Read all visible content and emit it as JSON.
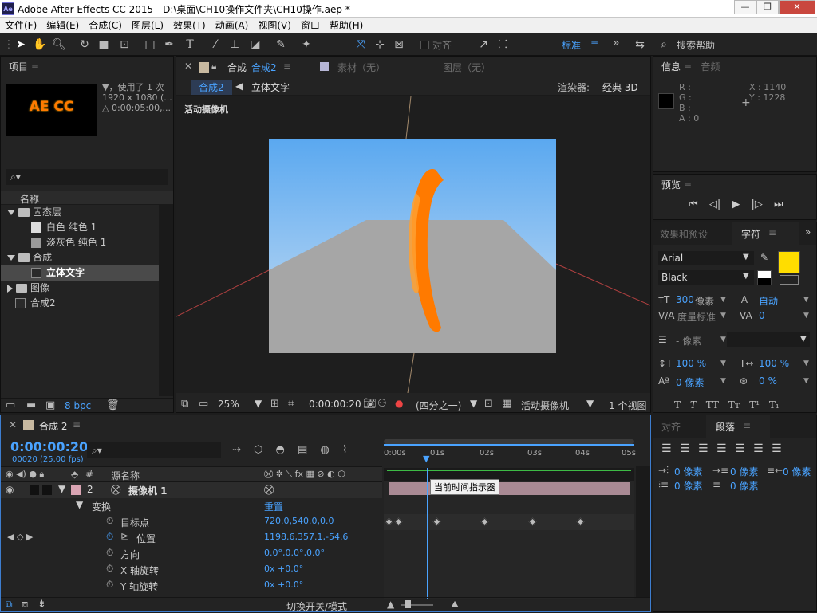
{
  "titlebar": {
    "app_icon": "Ae",
    "title": "Adobe After Effects CC 2015 - D:\\桌面\\CH10操作文件夹\\CH10操作.aep *",
    "minimize": "—",
    "restore": "❐",
    "close": "✕"
  },
  "menu": [
    "文件(F)",
    "编辑(E)",
    "合成(C)",
    "图层(L)",
    "效果(T)",
    "动画(A)",
    "视图(V)",
    "窗口",
    "帮助(H)"
  ],
  "toolbar": {
    "align_label": "对齐",
    "workspace": "标准",
    "search_label": "搜索帮助",
    "menu_icon": "≡",
    "more_icon": "»"
  },
  "project": {
    "title": "项目",
    "thumb_text": "AE CC",
    "info_line1": "▼，使用了 1 次",
    "info_line2": "1920 x 1080  (...",
    "info_line3": "△ 0:00:05:00,...",
    "search_placeholder": "",
    "col_name": "名称",
    "items": [
      {
        "name": "固态层",
        "type": "folder",
        "indent": 0,
        "expanded": true
      },
      {
        "name": "白色 纯色 1",
        "type": "solid-white",
        "indent": 2,
        "expanded": false
      },
      {
        "name": "淡灰色 纯色 1",
        "type": "solid-gray",
        "indent": 2,
        "expanded": false
      },
      {
        "name": "合成",
        "type": "folder",
        "indent": 0,
        "expanded": true
      },
      {
        "name": "立体文字",
        "type": "comp",
        "indent": 2,
        "expanded": false,
        "selected": true
      },
      {
        "name": "图像",
        "type": "folder",
        "indent": 0,
        "expanded": false
      },
      {
        "name": "合成2",
        "type": "comp",
        "indent": 1,
        "expanded": false
      }
    ],
    "bpc": "8 bpc"
  },
  "viewer": {
    "tab_comp_label": "合成",
    "tab_comp_name": "合成2",
    "tab_footage": "素材（无）",
    "tab_layer": "图层（无）",
    "breadcrumb1": "合成2",
    "breadcrumb2": "立体文字",
    "renderer_label": "渲染器:",
    "renderer_value": "经典 3D",
    "camera_label": "活动摄像机",
    "zoom": "25%",
    "timecode": "0:00:00:20",
    "resolution": "(四分之一)",
    "view_camera": "活动摄像机",
    "views": "1 个视图"
  },
  "info": {
    "title": "信息",
    "audio": "音频",
    "r": "R :",
    "g": "G :",
    "b": "B :",
    "a": "A : 0",
    "x": "X : 1140",
    "y": "Y : 1228"
  },
  "preview": {
    "title": "预览"
  },
  "effects_tab": "效果和预设",
  "character": {
    "title": "字符",
    "font": "Arial",
    "style": "Black",
    "size": "300",
    "size_unit": "像素",
    "leading": "自动",
    "kerning": "度量标准",
    "tracking": "0",
    "stroke": "- 像素",
    "vscale": "100 %",
    "hscale": "100 %",
    "baseline": "0 像素",
    "tsume": "0 %",
    "fill_color": "#ffdd00"
  },
  "timeline": {
    "comp_name": "合成 2",
    "timecode": "0:00:00:20",
    "frameinfo": "00020 (25.00 fps)",
    "col_num": "#",
    "col_source": "源名称",
    "ruler": [
      "0:00s",
      "01s",
      "02s",
      "03s",
      "04s",
      "05s"
    ],
    "tooltip": "当前时间指示器",
    "layers": [
      {
        "num": "2",
        "name": "摄像机 1",
        "kind": "layer"
      },
      {
        "name": "变换",
        "kind": "group",
        "value": "重置"
      },
      {
        "name": "目标点",
        "kind": "prop",
        "value": "720.0,540.0,0.0"
      },
      {
        "name": "位置",
        "kind": "prop",
        "value": "1198.6,357.1,-54.6",
        "keys": true
      },
      {
        "name": "方向",
        "kind": "prop",
        "value": "0.0°,0.0°,0.0°"
      },
      {
        "name": "X 轴旋转",
        "kind": "prop",
        "value": "0x +0.0°"
      },
      {
        "name": "Y 轴旋转",
        "kind": "prop",
        "value": "0x +0.0°"
      }
    ],
    "keyframe_times": [
      0,
      0.2,
      1,
      2,
      3,
      4
    ],
    "playhead_time": 0.8,
    "switch_mode": "切换开关/模式"
  },
  "align_tab": "对齐",
  "paragraph": {
    "title": "段落",
    "v1": "0 像素",
    "v2": "0 像素",
    "v3": "0 像素",
    "v4": "0 像素",
    "v5": "0 像素"
  },
  "colors": {
    "accent": "#4aa3ff",
    "orange": "#ff7a00",
    "sky_top": "#5aa8f0",
    "ground": "#a6a6a6"
  }
}
